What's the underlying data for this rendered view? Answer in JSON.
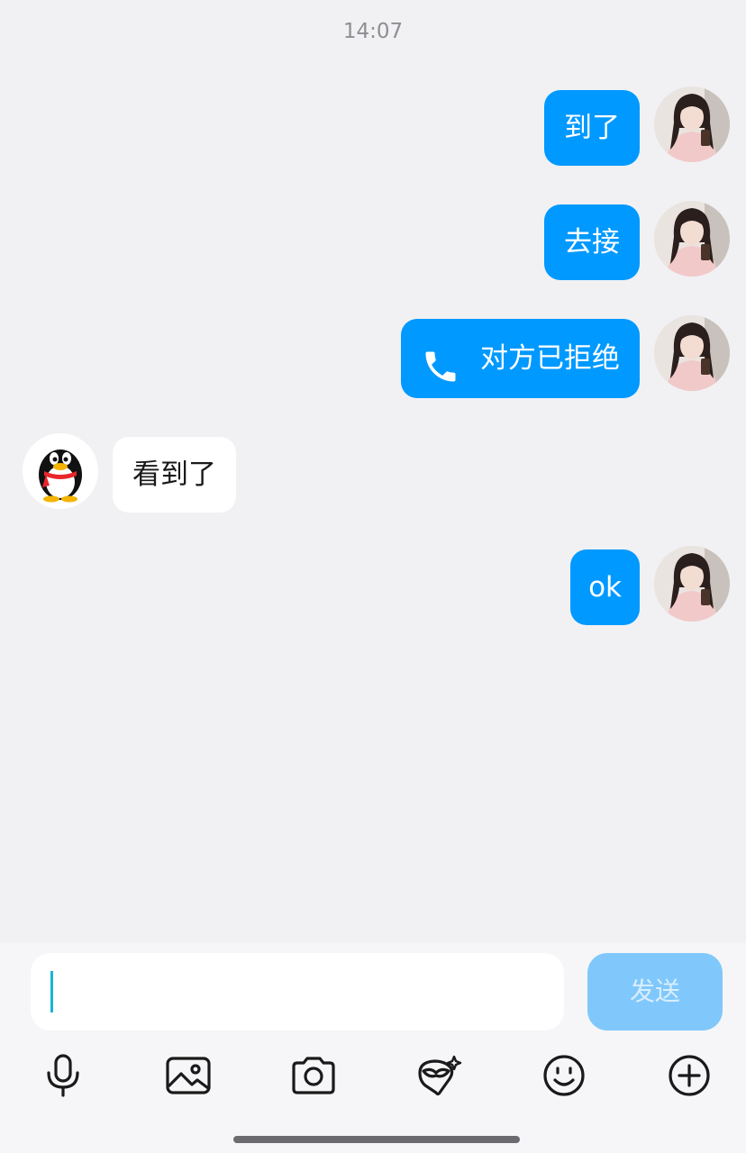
{
  "timestamp": "14:07",
  "messages": [
    {
      "side": "out",
      "text": "到了"
    },
    {
      "side": "out",
      "text": "去接"
    },
    {
      "side": "out",
      "text": "对方已拒绝",
      "icon": "phone-icon"
    },
    {
      "side": "in",
      "text": "看到了"
    },
    {
      "side": "out",
      "text": "ok"
    }
  ],
  "input": {
    "value": "",
    "placeholder": ""
  },
  "send_label": "发送",
  "toolbar_icons": [
    "microphone-icon",
    "image-icon",
    "camera-icon",
    "face-mask-icon",
    "emoji-icon",
    "plus-icon"
  ],
  "colors": {
    "outgoing_bubble": "#0099ff",
    "incoming_bubble": "#ffffff",
    "send_button": "#80c8fb",
    "background": "#f1f1f4"
  }
}
